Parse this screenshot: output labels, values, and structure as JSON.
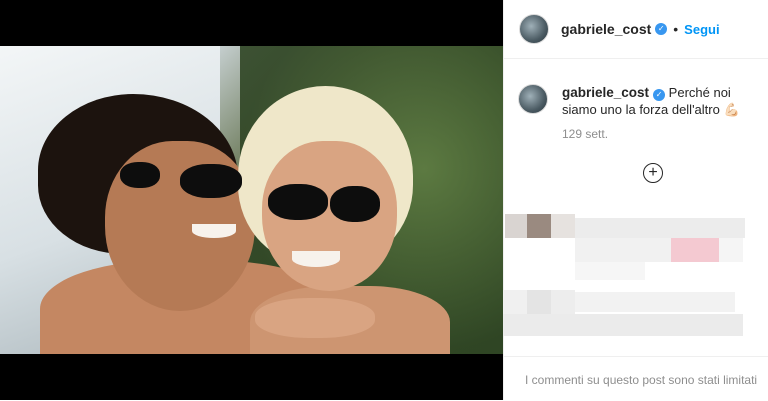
{
  "header": {
    "username": "gabriele_cost",
    "verified_mark": "✓",
    "separator": "•",
    "follow_label": "Segui"
  },
  "caption": {
    "username": "gabriele_cost",
    "verified_mark": "✓",
    "text": "Perché noi siamo uno la forza dell'altro 💪🏻",
    "timestamp": "129 sett."
  },
  "actions": {
    "load_more_icon": "plus-circle-icon",
    "load_more_glyph": "+"
  },
  "footer": {
    "comments_limited": "I commenti su questo post sono stati limitati"
  },
  "colors": {
    "accent": "#0095f6",
    "verified": "#3897f0",
    "muted": "#8e8e8e",
    "text": "#262626"
  }
}
